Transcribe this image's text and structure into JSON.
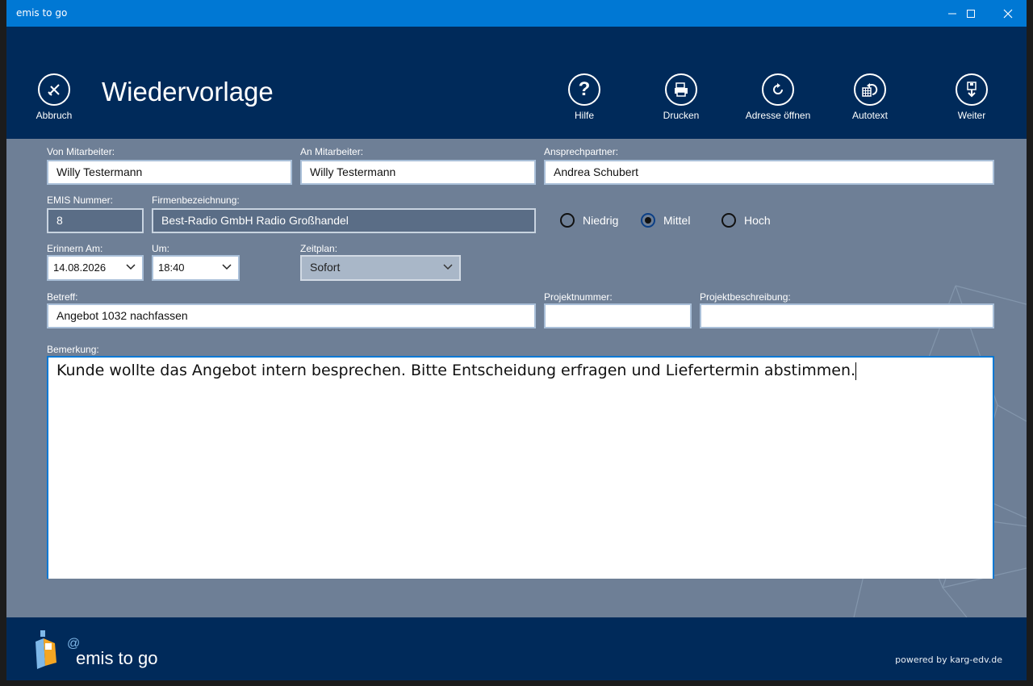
{
  "window": {
    "title": "emis to go"
  },
  "header": {
    "cancel_label": "Abbruch",
    "page_title": "Wiedervorlage",
    "buttons": {
      "help": "Hilfe",
      "print": "Drucken",
      "open_address": "Adresse öffnen",
      "autotext": "Autotext",
      "next": "Weiter"
    }
  },
  "form": {
    "from_employee": {
      "label": "Von Mitarbeiter:",
      "value": "Willy Testermann"
    },
    "to_employee": {
      "label": "An Mitarbeiter:",
      "value": "Willy Testermann"
    },
    "contact": {
      "label": "Ansprechpartner:",
      "value": "Andrea Schubert"
    },
    "emis_number": {
      "label": "EMIS Nummer:",
      "value": "8"
    },
    "company": {
      "label": "Firmenbezeichnung:",
      "value": "Best-Radio GmbH Radio Großhandel"
    },
    "priority": {
      "low": "Niedrig",
      "medium": "Mittel",
      "high": "Hoch",
      "selected": "Mittel"
    },
    "remind_date": {
      "label": "Erinnern Am:",
      "value": "14.08.2026"
    },
    "remind_time": {
      "label": "Um:",
      "value": "18:40"
    },
    "schedule": {
      "label": "Zeitplan:",
      "value": "Sofort"
    },
    "subject": {
      "label": "Betreff:",
      "value": "Angebot 1032 nachfassen"
    },
    "project_number": {
      "label": "Projektnummer:",
      "value": ""
    },
    "project_description": {
      "label": "Projektbeschreibung:",
      "value": ""
    },
    "remark": {
      "label": "Bemerkung:",
      "value": "Kunde wollte das Angebot intern besprechen. Bitte Entscheidung erfragen und Liefertermin abstimmen."
    }
  },
  "footer": {
    "brand": "emis to go",
    "at_symbol": "@",
    "powered": "powered by karg-edv.de"
  },
  "colors": {
    "titlebar": "#0078d4",
    "header": "#002a5a",
    "content": "#6e7f96",
    "readonly": "#5a6d86"
  }
}
